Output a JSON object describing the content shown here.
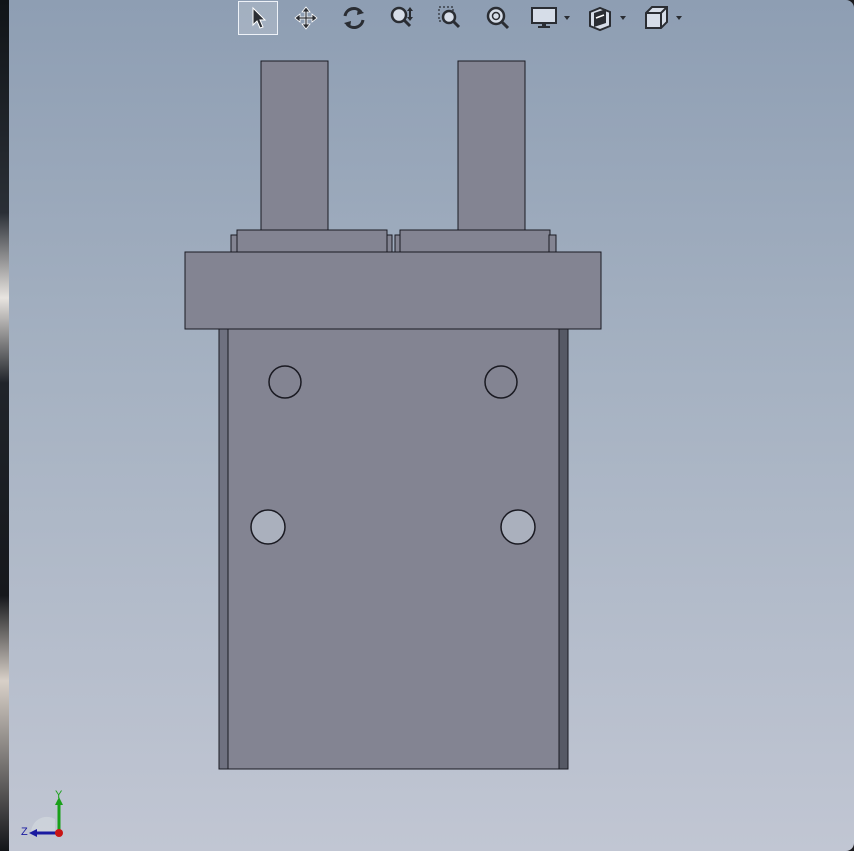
{
  "toolbar": {
    "tools": [
      {
        "name": "select-tool",
        "icon": "arrow-pointer-icon",
        "active": true
      },
      {
        "name": "pan-tool",
        "icon": "move-arrows-icon"
      },
      {
        "name": "rotate-tool",
        "icon": "rotate-icon"
      },
      {
        "name": "zoom-in-out-tool",
        "icon": "zoom-in-out-icon"
      },
      {
        "name": "zoom-to-area-tool",
        "icon": "zoom-area-icon"
      },
      {
        "name": "zoom-to-fit-tool",
        "icon": "zoom-fit-icon"
      },
      {
        "name": "display-style-dropdown",
        "icon": "monitor-icon"
      },
      {
        "name": "section-view-dropdown",
        "icon": "section-view-icon"
      },
      {
        "name": "view-orientation-dropdown",
        "icon": "cube-icon"
      }
    ]
  },
  "triad": {
    "x_label": "",
    "y_label": "Y",
    "z_label": "Z"
  },
  "colors": {
    "part_face": "#838492",
    "part_dark": "#565965",
    "edge": "#1a1a22",
    "viewport_top": "#8e9eb3",
    "viewport_bottom": "#c1c6d3",
    "triad_y": "#1aa01a",
    "triad_z": "#1a1aa0",
    "triad_x": "#c81414"
  }
}
